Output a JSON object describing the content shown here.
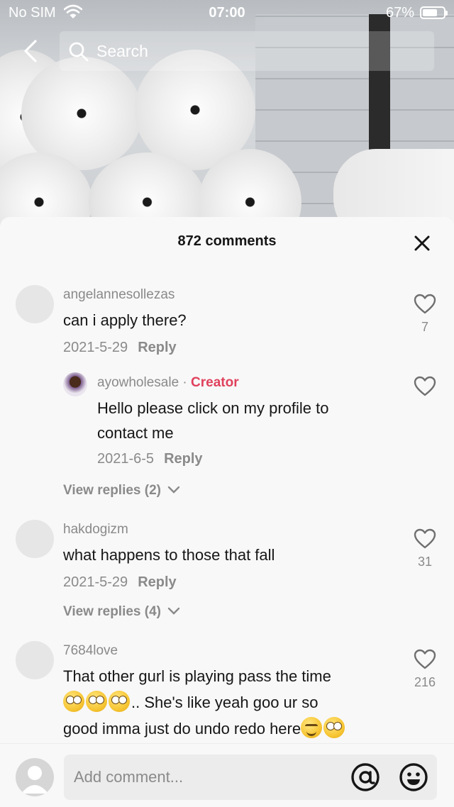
{
  "status_bar": {
    "carrier": "No SIM",
    "time": "07:00",
    "battery": "67%"
  },
  "top_bar": {
    "search_label": "Search"
  },
  "sheet": {
    "title": "872 comments"
  },
  "comments": [
    {
      "username": "angelannesollezas",
      "text": "can i apply there?",
      "date": "2021-5-29",
      "reply_label": "Reply",
      "likes": "7"
    },
    {
      "username": "ayowholesale",
      "creator_separator": "·",
      "creator_tag": "Creator",
      "text_line1": "Hello please click on my profile to",
      "text_line2": "contact me",
      "date": "2021-6-5",
      "reply_label": "Reply"
    },
    {
      "view_replies": "View replies (2)"
    },
    {
      "username": "hakdogizm",
      "text": "what happens to those that fall",
      "date": "2021-5-29",
      "reply_label": "Reply",
      "likes": "31",
      "view_replies": "View replies (4)"
    },
    {
      "username": "7684love",
      "text_line1": "That other gurl is playing pass the time",
      "text_line2": ".. She's like yeah goo ur so",
      "text_line3": "good imma just do undo redo here",
      "likes": "216"
    }
  ],
  "composer": {
    "placeholder": "Add comment..."
  }
}
